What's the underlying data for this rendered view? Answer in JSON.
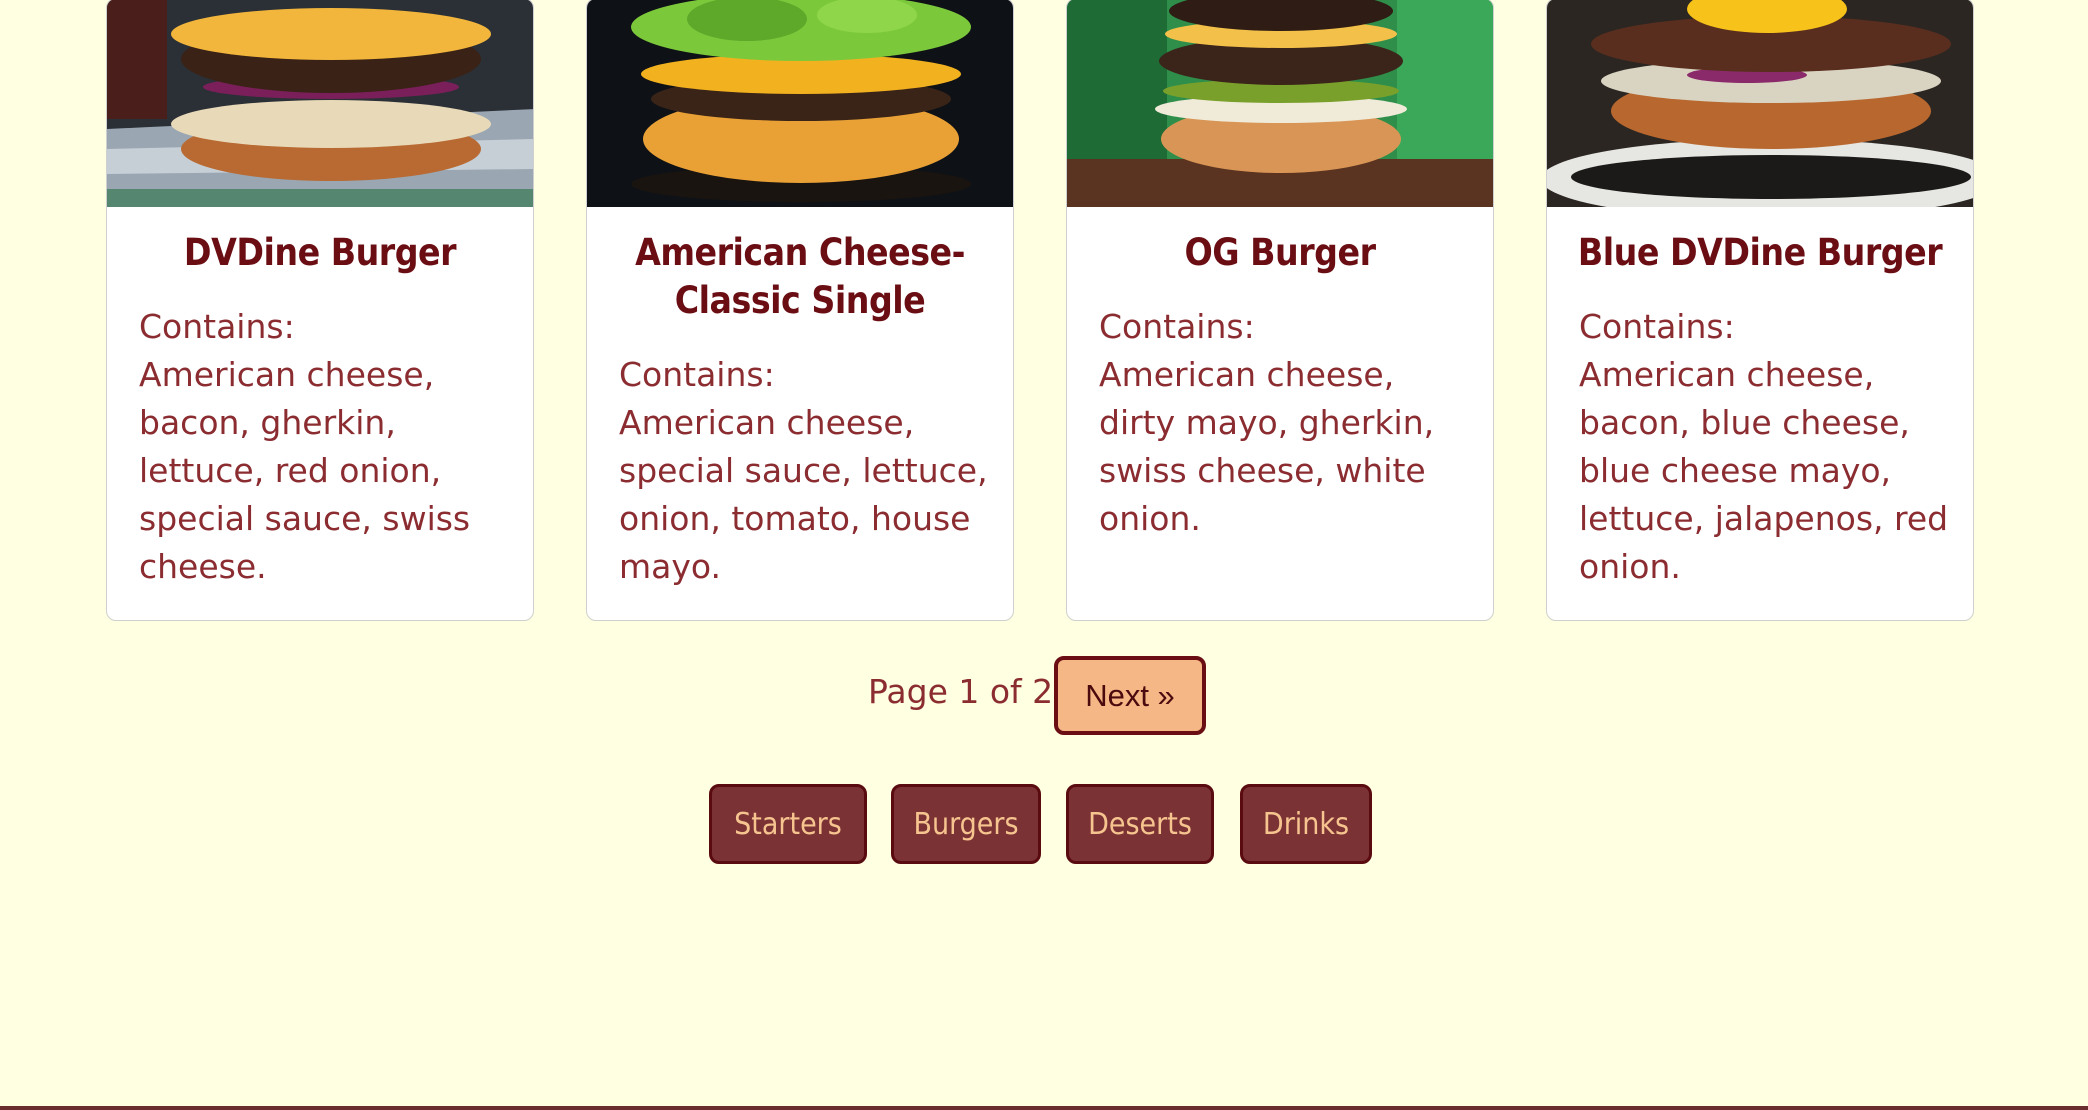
{
  "cards": [
    {
      "title_lines": [
        "DVDine Burger",
        ""
      ],
      "contains_label": "Contains:",
      "description": "American cheese, bacon, gherkin, lettuce, red onion, special sauce, swiss cheese.",
      "image_icon": "burger-photo"
    },
    {
      "title_lines": [
        "American Cheese-",
        "Classic Single"
      ],
      "contains_label": "Contains:",
      "description": "American cheese, special sauce, lettuce, onion, tomato, house mayo.",
      "image_icon": "burger-photo"
    },
    {
      "title_lines": [
        "OG Burger",
        ""
      ],
      "contains_label": "Contains:",
      "description": "American cheese, dirty mayo, gherkin, swiss cheese, white onion.",
      "image_icon": "burger-photo"
    },
    {
      "title_lines": [
        "Blue DVDine Burger",
        ""
      ],
      "contains_label": "Contains:",
      "description": "American cheese, bacon, blue cheese, blue cheese mayo, lettuce, jalapenos, red onion.",
      "image_icon": "burger-photo"
    }
  ],
  "pagination": {
    "page_text": "Page 1 of 2",
    "next_label": "Next »"
  },
  "categories": [
    "Starters",
    "Burgers",
    "Deserts",
    "Drinks"
  ],
  "colors": {
    "background": "#ffffe2",
    "title": "#6a0e14",
    "body_text": "#8b2c31",
    "next_button_bg": "#f5b785",
    "category_button_bg": "#7b3234",
    "category_button_text": "#f6c48f"
  }
}
